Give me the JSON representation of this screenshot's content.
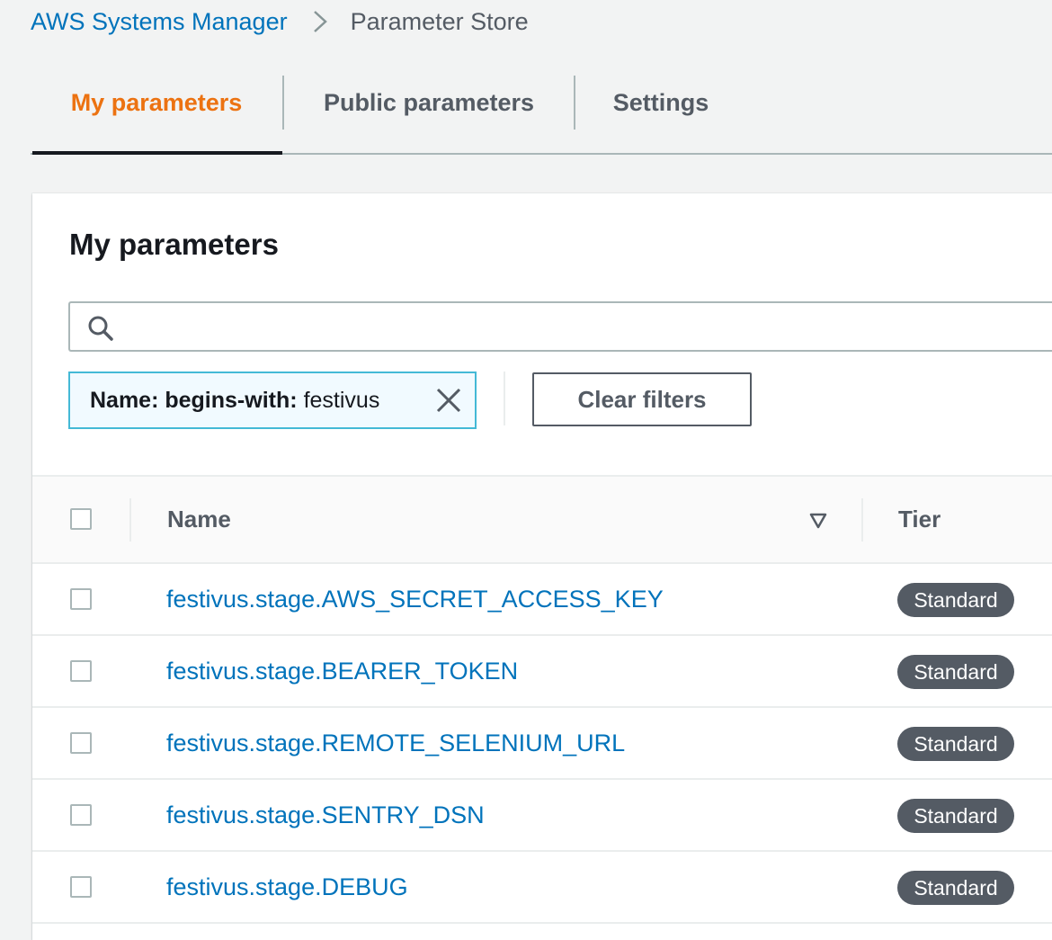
{
  "breadcrumb": {
    "parent": "AWS Systems Manager",
    "current": "Parameter Store",
    "separator_icon": "chevron-right-icon"
  },
  "tabs": [
    {
      "label": "My parameters",
      "active": true
    },
    {
      "label": "Public parameters",
      "active": false
    },
    {
      "label": "Settings",
      "active": false
    }
  ],
  "panel": {
    "title": "My parameters",
    "search": {
      "value": "",
      "placeholder": "",
      "icon": "search-icon"
    },
    "filter_token": {
      "key": "Name: begins-with:",
      "value": "festivus",
      "close_icon": "close-icon"
    },
    "clear_filters_label": "Clear filters"
  },
  "table": {
    "columns": {
      "name": "Name",
      "tier": "Tier"
    },
    "sort_icon": "sort-descending-icon",
    "rows": [
      {
        "name": "festivus.stage.AWS_SECRET_ACCESS_KEY",
        "tier": "Standard"
      },
      {
        "name": "festivus.stage.BEARER_TOKEN",
        "tier": "Standard"
      },
      {
        "name": "festivus.stage.REMOTE_SELENIUM_URL",
        "tier": "Standard"
      },
      {
        "name": "festivus.stage.SENTRY_DSN",
        "tier": "Standard"
      },
      {
        "name": "festivus.stage.DEBUG",
        "tier": "Standard"
      }
    ]
  },
  "colors": {
    "link": "#0073bb",
    "active_tab": "#ec7211",
    "badge": "#545b64",
    "token_border": "#44b9d6",
    "background": "#f2f3f3"
  }
}
